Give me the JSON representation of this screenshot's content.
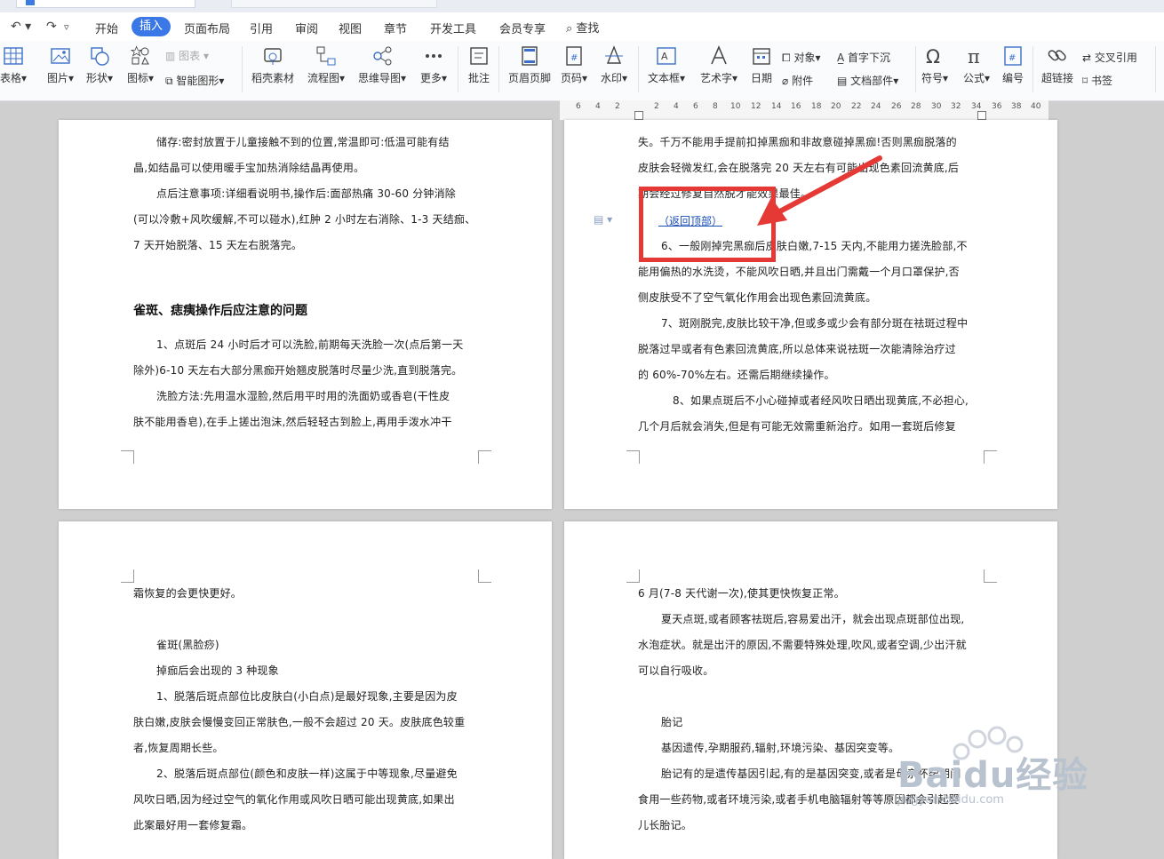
{
  "menu": {
    "items": [
      "开始",
      "插入",
      "页面布局",
      "引用",
      "审阅",
      "视图",
      "章节",
      "开发工具",
      "会员专享"
    ],
    "active": "插入",
    "search": "查找"
  },
  "ribbon": {
    "table": "表格",
    "picture": "图片",
    "shape": "形状",
    "icon": "图标",
    "chart": "图表",
    "smart": "智能图形",
    "material": "稻壳素材",
    "flow": "流程图",
    "mind": "思维导图",
    "more": "更多",
    "comment": "批注",
    "header_footer": "页眉页脚",
    "page_num": "页码",
    "watermark": "水印",
    "textbox": "文本框",
    "art": "艺术字",
    "date": "日期",
    "object": "对象",
    "attach": "附件",
    "dropcap": "首字下沉",
    "docpart": "文档部件",
    "symbol": "符号",
    "formula": "公式",
    "number": "编号",
    "hyperlink": "超链接",
    "crossref": "交叉引用",
    "bookmark": "书签"
  },
  "ruler": {
    "ticks": [
      "6",
      "4",
      "2",
      "2",
      "4",
      "6",
      "8",
      "10",
      "12",
      "14",
      "16",
      "18",
      "20",
      "22",
      "24",
      "26",
      "28",
      "30",
      "32",
      "34",
      "36",
      "38",
      "40"
    ]
  },
  "page1": {
    "lines": [
      "储存:密封放置于儿童接触不到的位置,常温即可:低温可能有结",
      "晶,如结晶可以使用暖手宝加热消除结晶再使用。",
      "点后注意事项:详细看说明书,操作后:面部热痛 30-60 分钟消除",
      "(可以冷敷+风吹缓解,不可以碰水),红肿 2 小时左右消除、1-3 天结痂、",
      "7 天开始脱落、15 天左右脱落完。"
    ],
    "heading": "雀斑、痣痍操作后应注意的问题",
    "lines2": [
      "1、点斑后 24 小时后才可以洗脸,前期每天洗脸一次(点后第一天",
      "除外)6-10 天左右大部分黑痂开始翘皮脱落时尽量少洗,直到脱落完。",
      "洗脸方法:先用温水湿脸,然后用平时用的洗面奶或香皂(干性皮",
      "肤不能用香皂),在手上搓出泡沫,然后轻轻古到脸上,再用手泼水冲干"
    ]
  },
  "page2": {
    "lines": [
      "失。千万不能用手提前扣掉黑痂和非故意碰掉黑痂!否则黑痂脱落的",
      "皮肤会轻微发红,会在脱落完 20 天左右有可能出现色素回流黄底,后",
      "期会经过修复自然脱才能效果最佳。"
    ],
    "link": "（返回顶部）",
    "lines2": [
      "6、一般刚掉完黑痂后皮肤白嫩,7-15 天内,不能用力搓洗脸部,不",
      "能用偏热的水洗烫，不能风吹日晒,并且出门需戴一个月口罩保护,否",
      "侧皮肤受不了空气氧化作用会出现色素回流黄底。",
      "7、斑刚脱完,皮肤比较干净,但或多或少会有部分斑在祛斑过程中",
      "脱落过早或者有色素回流黄底,所以总体来说祛斑一次能清除治疗过",
      "的 60%-70%左右。还需后期继续操作。",
      "8、如果点斑后不小心碰掉或者经风吹日晒出现黄底,不必担心,",
      "几个月后就会消失,但是有可能无效需重新治疗。如用一套斑后修复"
    ]
  },
  "page3": {
    "lines": [
      "霜恢复的会更快更好。",
      "雀斑(黑脸痧)",
      "掉痂后会出现的 3 种现象",
      "1、脱落后斑点部位比皮肤白(小白点)是最好现象,主要是因为皮",
      "肤白嫩,皮肤会慢慢变回正常肤色,一般不会超过 20 天。皮肤底色较重",
      "者,恢复周期长些。",
      "2、脱落后斑点部位(颜色和皮肤一样)这属于中等现象,尽量避免",
      "风吹日晒,因为经过空气的氧化作用或风吹日晒可能出现黄底,如果出",
      "此案最好用一套修复霜。"
    ]
  },
  "page4": {
    "lines": [
      "6 月(7-8 天代谢一次),使其更快恢复正常。",
      "夏天点斑,或者顾客祛斑后,容易爱出汗，就会出现点斑部位出现,",
      "水泡症状。就是出汗的原因,不需要特殊处理,吹风,或者空调,少出汗就",
      "可以自行吸收。",
      "胎记",
      "基因遗传,孕期服药,辐射,环境污染、基因突变等。",
      "胎记有的是遗传基因引起,有的是基因突变,或者是母亲怀孕期间",
      "食用一些药物,或者环境污染,或者手机电脑辐射等等原因都会引起婴",
      "儿长胎记。"
    ]
  },
  "watermark": {
    "brand": "Baidu经验",
    "url": "jingyan.baidu.com"
  },
  "colors": {
    "accent": "#3b78e7",
    "annotation": "#e53935",
    "link": "#1a4fb5"
  }
}
